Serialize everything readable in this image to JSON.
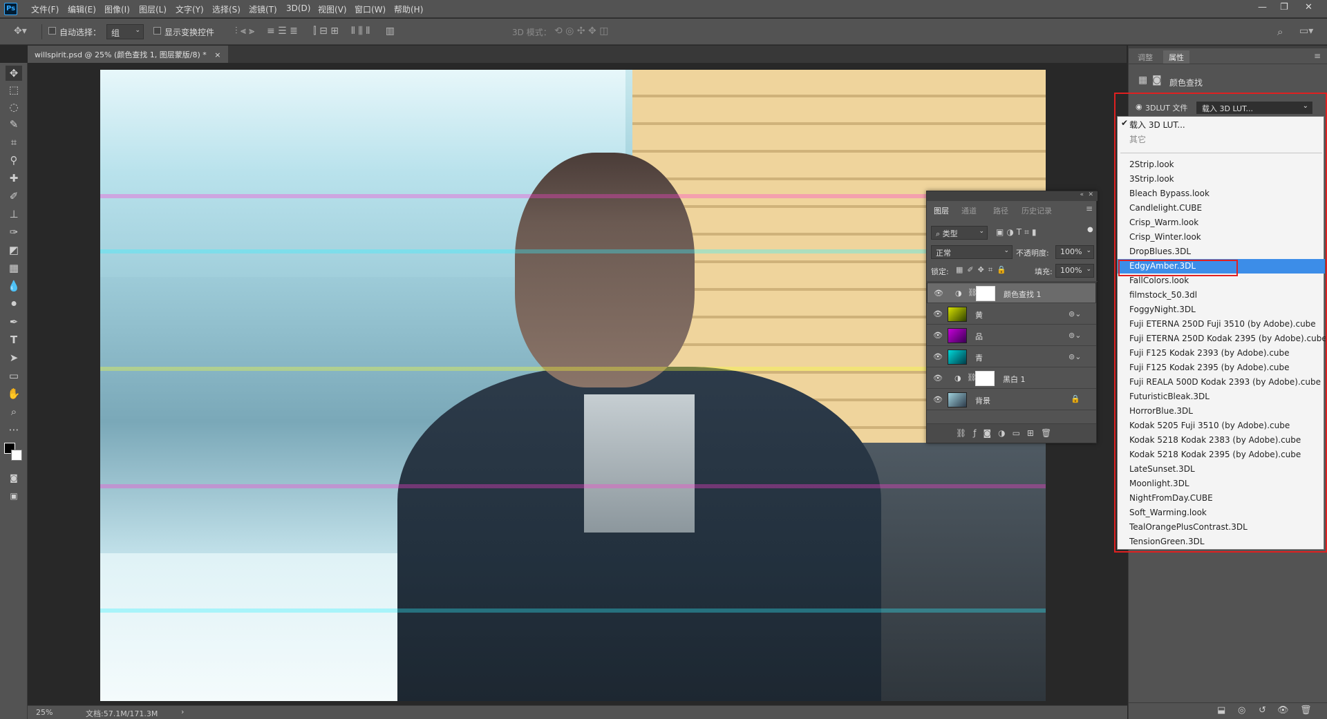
{
  "app": {
    "logo_text": "Ps"
  },
  "menu": [
    "文件(F)",
    "编辑(E)",
    "图像(I)",
    "图层(L)",
    "文字(Y)",
    "选择(S)",
    "滤镜(T)",
    "3D(D)",
    "视图(V)",
    "窗口(W)",
    "帮助(H)"
  ],
  "options": {
    "auto_select_label": "自动选择：",
    "auto_select_value": "组",
    "show_transform_label": "显示变换控件",
    "mode_3d_label": "3D 模式："
  },
  "document": {
    "tab_title": "willspirit.psd @ 25% (颜色查找 1, 图层蒙版/8) *",
    "close": "×"
  },
  "status": {
    "zoom": "25%",
    "doc_size": "文档:57.1M/171.3M",
    "arrow": "›"
  },
  "properties": {
    "tabs": [
      "调整",
      "属性"
    ],
    "title": "颜色查找",
    "lut_radio_label": "3DLUT 文件",
    "lut_selected": "载入 3D LUT..."
  },
  "lut_menu": {
    "top_items": [
      "载入 3D LUT...",
      "其它"
    ],
    "items": [
      "2Strip.look",
      "3Strip.look",
      "Bleach Bypass.look",
      "Candlelight.CUBE",
      "Crisp_Warm.look",
      "Crisp_Winter.look",
      "DropBlues.3DL",
      "EdgyAmber.3DL",
      "FallColors.look",
      "filmstock_50.3dl",
      "FoggyNight.3DL",
      "Fuji ETERNA 250D Fuji 3510 (by Adobe).cube",
      "Fuji ETERNA 250D Kodak 2395 (by Adobe).cube",
      "Fuji F125 Kodak 2393 (by Adobe).cube",
      "Fuji F125 Kodak 2395 (by Adobe).cube",
      "Fuji REALA 500D Kodak 2393 (by Adobe).cube",
      "FuturisticBleak.3DL",
      "HorrorBlue.3DL",
      "Kodak 5205 Fuji 3510 (by Adobe).cube",
      "Kodak 5218 Kodak 2383 (by Adobe).cube",
      "Kodak 5218 Kodak 2395 (by Adobe).cube",
      "LateSunset.3DL",
      "Moonlight.3DL",
      "NightFromDay.CUBE",
      "Soft_Warming.look",
      "TealOrangePlusContrast.3DL",
      "TensionGreen.3DL"
    ],
    "highlighted": "EdgyAmber.3DL"
  },
  "layers": {
    "tabs": [
      "图层",
      "通道",
      "路径",
      "历史记录"
    ],
    "kind_filter": "类型",
    "blend_mode": "正常",
    "opacity_label": "不透明度:",
    "opacity_value": "100%",
    "lock_label": "锁定:",
    "fill_label": "填充:",
    "fill_value": "100%",
    "rows": [
      {
        "name": "颜色查找 1"
      },
      {
        "name": "黄"
      },
      {
        "name": "品"
      },
      {
        "name": "青"
      },
      {
        "name": "黑白 1"
      },
      {
        "name": "背景"
      }
    ]
  },
  "colors": {
    "highlight": "#3c8de8",
    "annotation_red": "#e02020"
  }
}
